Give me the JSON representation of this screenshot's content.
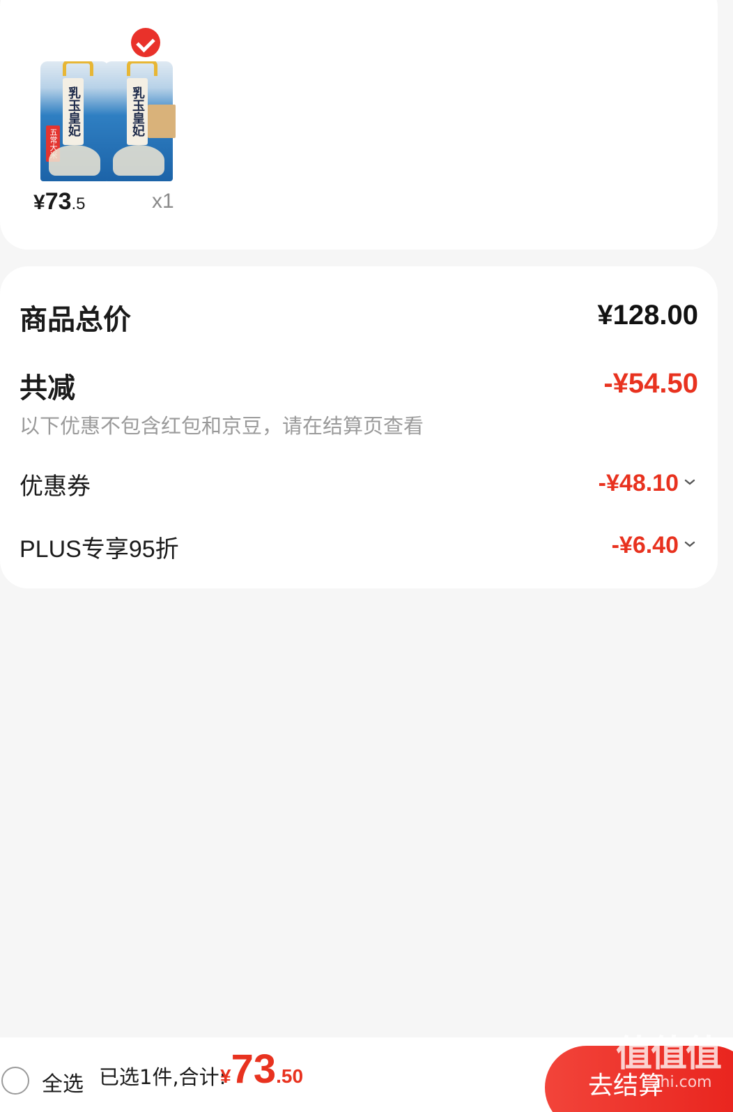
{
  "product": {
    "price_currency": "¥",
    "price_integer": "73",
    "price_decimal": ".5",
    "quantity": "x1",
    "selected": true,
    "image_alt": "rice-bag-product-image",
    "bag_label": "乳玉皇妃",
    "bag_tag": "五常大米"
  },
  "summary": {
    "total_label": "商品总价",
    "total_value": "¥128.00",
    "reduce_label": "共减",
    "reduce_value": "-¥54.50",
    "note": "以下优惠不包含红包和京豆，请在结算页查看",
    "discounts": [
      {
        "label": "优惠券",
        "value": "-¥48.10"
      },
      {
        "label": "PLUS专享95折",
        "value": "-¥6.40"
      }
    ]
  },
  "bottom_bar": {
    "select_all": "全选",
    "selected_text": "已选1件,合计:",
    "total_currency": "¥",
    "total_integer": "73",
    "total_decimal": ".50",
    "checkout_label": "去结算"
  },
  "watermark": {
    "main": "值值值",
    "sub": "zhi.com"
  },
  "colors": {
    "accent_red": "#e8321f",
    "background": "#f6f6f6",
    "card": "#ffffff",
    "muted_text": "#9a9a9a"
  }
}
